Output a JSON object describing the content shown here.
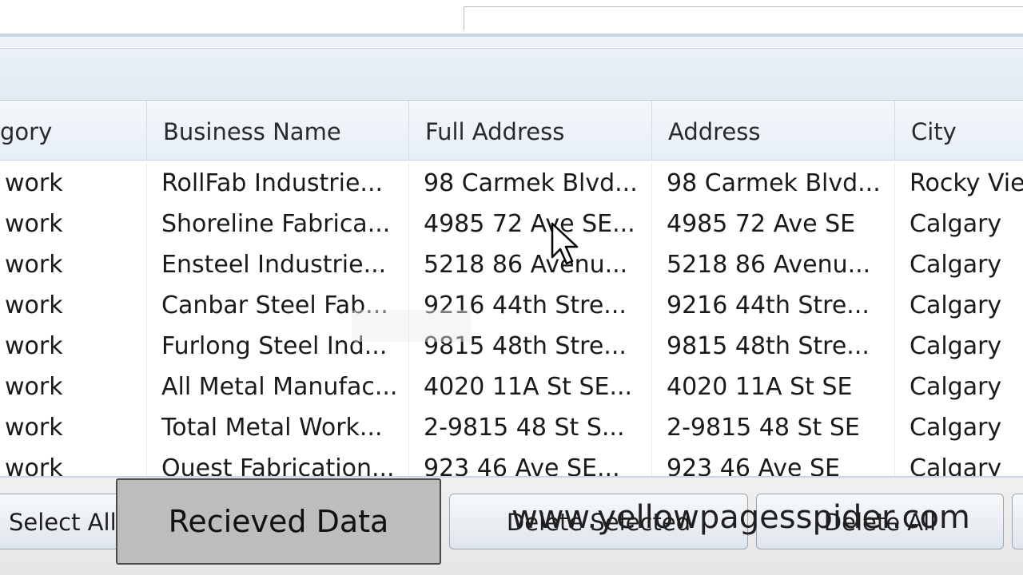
{
  "grid": {
    "columns": [
      "gory",
      "Business Name",
      "Full Address",
      "Address",
      "City"
    ],
    "rows": [
      [
        "work",
        "RollFab Industrie...",
        "98 Carmek Blvd...",
        "98 Carmek Blvd...",
        "Rocky View"
      ],
      [
        "work",
        "Shoreline Fabrica...",
        "4985 72 Ave SE...",
        "4985 72 Ave SE",
        "Calgary"
      ],
      [
        "work",
        "Ensteel Industrie...",
        "5218 86 Avenu...",
        "5218 86 Avenu...",
        "Calgary"
      ],
      [
        "work",
        "Canbar Steel Fab...",
        "9216 44th Stre...",
        "9216 44th Stre...",
        "Calgary"
      ],
      [
        "work",
        "Furlong Steel Ind...",
        "9815 48th Stre...",
        "9815 48th Stre...",
        "Calgary"
      ],
      [
        "work",
        "All Metal Manufac...",
        "4020 11A St SE...",
        "4020 11A St SE",
        "Calgary"
      ],
      [
        "work",
        "Total Metal Work...",
        "2-9815 48 St S...",
        "2-9815 48 St SE",
        "Calgary"
      ],
      [
        "work",
        "Quest Fabrication...",
        "923 46 Ave SE...",
        "923 46 Ave SE",
        "Calgary"
      ]
    ]
  },
  "buttons": {
    "select_all": "Select All",
    "delete_selected": "Delete Selected",
    "delete_all": "Delete All"
  },
  "overlay": {
    "label": "Recieved Data",
    "watermark": "www.yellowpagesspider.com"
  },
  "colors": {
    "header_bg": "#e7eef6",
    "overlay_bg": "#bdbdbd"
  },
  "icons": {
    "cursor": "arrow-cursor-icon"
  }
}
